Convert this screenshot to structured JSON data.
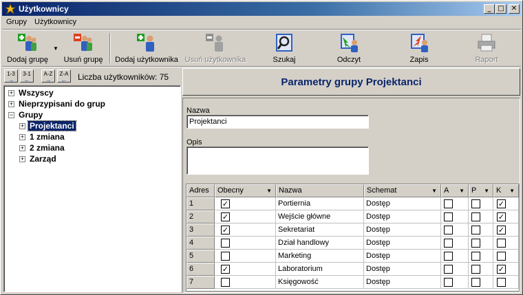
{
  "window": {
    "title": "Użytkownicy",
    "controls": {
      "minimize": "_",
      "maximize": "□",
      "close": "✕"
    }
  },
  "menu": [
    "Grupy",
    "Użytkownicy"
  ],
  "toolbar": [
    {
      "label": "Dodaj grupę",
      "icon": "add-group-icon",
      "enabled": true
    },
    {
      "label": "Usuń grupę",
      "icon": "remove-group-icon",
      "enabled": true
    },
    {
      "label": "Dodaj użytkownika",
      "icon": "add-user-icon",
      "enabled": true
    },
    {
      "label": "Usuń użytkownika",
      "icon": "remove-user-icon",
      "enabled": false
    },
    {
      "label": "Szukaj",
      "icon": "search-icon",
      "enabled": true
    },
    {
      "label": "Odczyt",
      "icon": "read-icon",
      "enabled": true
    },
    {
      "label": "Zapis",
      "icon": "write-icon",
      "enabled": true
    },
    {
      "label": "Raport",
      "icon": "report-icon",
      "enabled": false
    }
  ],
  "sort_buttons": [
    {
      "text": "1-3",
      "arrow": "→"
    },
    {
      "text": "3-1",
      "arrow": "←"
    },
    {
      "text": "A-Z",
      "arrow": "→"
    },
    {
      "text": "Z-A",
      "arrow": "←"
    }
  ],
  "user_count": "Liczba użytkowników: 75",
  "tree": {
    "nodes": [
      {
        "label": "Wszyscy",
        "expander": "+",
        "level": 0
      },
      {
        "label": "Nieprzypisani do grup",
        "expander": "+",
        "level": 0
      },
      {
        "label": "Grupy",
        "expander": "−",
        "level": 0
      },
      {
        "label": "Projektanci",
        "expander": "+",
        "level": 1,
        "selected": true
      },
      {
        "label": "1 zmiana",
        "expander": "+",
        "level": 1
      },
      {
        "label": "2 zmiana",
        "expander": "+",
        "level": 1
      },
      {
        "label": "Zarząd",
        "expander": "+",
        "level": 1
      }
    ]
  },
  "panel": {
    "title": "Parametry grupy Projektanci",
    "name_label": "Nazwa",
    "name_value": "Projektanci",
    "description_label": "Opis",
    "description_value": ""
  },
  "grid": {
    "columns": [
      {
        "label": "Adres",
        "dropdown": false
      },
      {
        "label": "Obecny",
        "dropdown": true
      },
      {
        "label": "Nazwa",
        "dropdown": false
      },
      {
        "label": "Schemat",
        "dropdown": true
      },
      {
        "label": "A",
        "dropdown": true
      },
      {
        "label": "P",
        "dropdown": true
      },
      {
        "label": "K",
        "dropdown": true
      }
    ],
    "dropdown_glyph": "▼",
    "check_glyph": "✓",
    "rows": [
      {
        "adres": "1",
        "obecny": true,
        "nazwa": "Portiernia",
        "schemat": "Dostęp",
        "a": false,
        "p": false,
        "k": true
      },
      {
        "adres": "2",
        "obecny": true,
        "nazwa": "Wejście główne",
        "schemat": "Dostęp",
        "a": false,
        "p": false,
        "k": true
      },
      {
        "adres": "3",
        "obecny": true,
        "nazwa": "Sekretariat",
        "schemat": "Dostęp",
        "a": false,
        "p": false,
        "k": true
      },
      {
        "adres": "4",
        "obecny": false,
        "nazwa": "Dział handlowy",
        "schemat": "Dostęp",
        "a": false,
        "p": false,
        "k": false
      },
      {
        "adres": "5",
        "obecny": false,
        "nazwa": "Marketing",
        "schemat": "Dostęp",
        "a": false,
        "p": false,
        "k": false
      },
      {
        "adres": "6",
        "obecny": true,
        "nazwa": "Laboratorium",
        "schemat": "Dostęp",
        "a": false,
        "p": false,
        "k": true
      },
      {
        "adres": "7",
        "obecny": false,
        "nazwa": "Księgowość",
        "schemat": "Dostęp",
        "a": false,
        "p": false,
        "k": false
      }
    ]
  },
  "colors": {
    "titlebar_start": "#0a246a",
    "titlebar_end": "#a6caf0",
    "header_text": "#0a246a",
    "selection": "#0a246a"
  }
}
